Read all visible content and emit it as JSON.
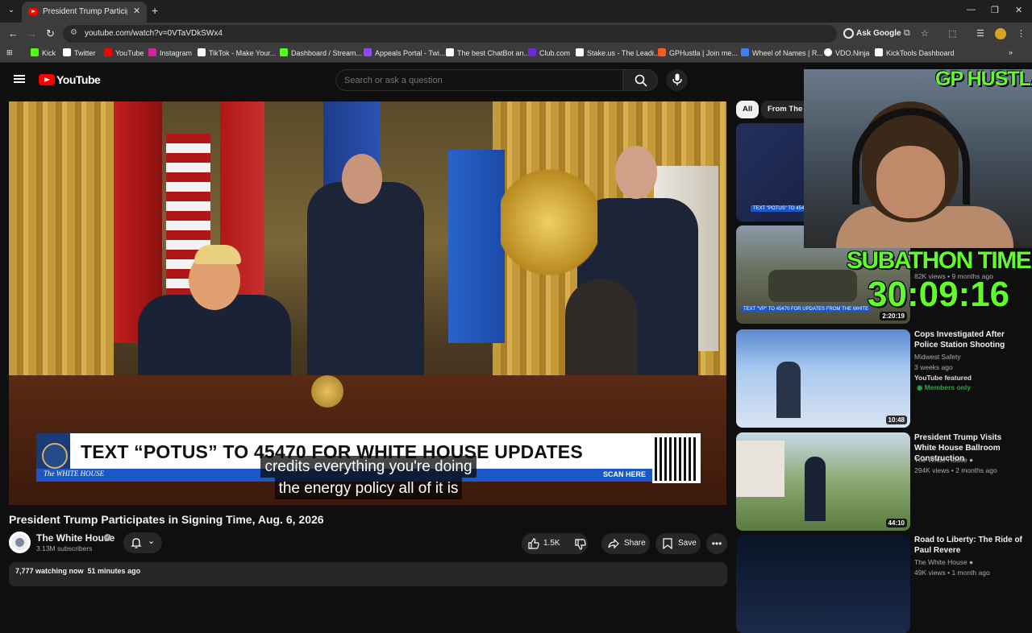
{
  "browser": {
    "tab_title": "President Trump Participates in",
    "url": "youtube.com/watch?v=0VTaVDkSWx4",
    "ask_google": "Ask Google",
    "bookmarks": [
      {
        "label": "Kick",
        "color": "#53fc18"
      },
      {
        "label": "Twitter",
        "color": "#ffffff"
      },
      {
        "label": "YouTube",
        "color": "#ff0000"
      },
      {
        "label": "Instagram",
        "color": "#d6249f"
      },
      {
        "label": "TikTok - Make Your...",
        "color": "#ffffff"
      },
      {
        "label": "Dashboard / Stream...",
        "color": "#53fc18"
      },
      {
        "label": "Appeals Portal - Twi...",
        "color": "#9146ff"
      },
      {
        "label": "The best ChatBot an...",
        "color": "#ffffff"
      },
      {
        "label": "Club.com",
        "color": "#6a2bd9"
      },
      {
        "label": "Stake.us - The Leadi...",
        "color": "#ffffff"
      },
      {
        "label": "GPHustla | Join me...",
        "color": "#ff5a1f"
      },
      {
        "label": "Wheel of Names | R...",
        "color": "#3b82f6"
      },
      {
        "label": "VDO.Ninja",
        "color": "#ffffff"
      },
      {
        "label": "KickTools Dashboard",
        "color": "#ffffff"
      }
    ]
  },
  "youtube": {
    "wordmark": "YouTube",
    "search_placeholder": "Search or ask a question"
  },
  "player": {
    "lower_third": "TEXT “POTUS” TO 45470 FOR WHITE HOUSE UPDATES",
    "brand": "The WHITE HOUSE",
    "scan_here": "SCAN HERE",
    "caption_line_1": "credits everything you're doing",
    "caption_line_2": "the energy policy all of it is"
  },
  "video": {
    "title": "President Trump Participates in Signing Time, Aug. 6, 2026",
    "channel": "The White House",
    "subscribers": "3.13M subscribers",
    "likes": "1.5K",
    "share": "Share",
    "save": "Save",
    "watching": "7,777 watching now",
    "started": "51 minutes ago"
  },
  "sidebar": {
    "chips": [
      "All",
      "From The W"
    ],
    "recommendations": [
      {
        "title": "",
        "thumb_text": "TEXT \"POTUS\" TO 454",
        "duration": ""
      },
      {
        "title": "",
        "meta": "82K views • 9 months ago",
        "thumb_text": "TEXT \"VP\" TO 45470 FOR UPDATES FROM THE WHITE",
        "duration": "2:20:19"
      },
      {
        "title": "Cops Investigated After Police Station Shooting",
        "channel": "Midwest Safety",
        "meta": "3 weeks ago",
        "badge": "YouTube featured",
        "members": "Members only",
        "duration": "10:48"
      },
      {
        "title": "President Trump Visits White House Ballroom Construction",
        "channel": "The White House",
        "meta": "294K views • 2 months ago",
        "duration": "44:10"
      },
      {
        "title": "Road to Liberty: The Ride of Paul Revere",
        "channel": "The White House",
        "meta": "49K views • 1 month ago"
      }
    ]
  },
  "overlay": {
    "brand": "GP HUSTLA",
    "subathon_label": "SUBATHON TIMER",
    "subathon_timer": "30:09:16"
  }
}
